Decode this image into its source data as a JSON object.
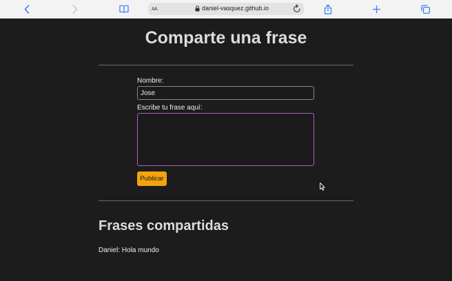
{
  "browser": {
    "aa_label": "AA",
    "url": "daniel-vasquez.github.io",
    "icons": [
      "chevron-left-icon",
      "chevron-right-icon",
      "book-icon",
      "lock-icon",
      "reload-icon",
      "share-icon",
      "plus-icon",
      "tabs-icon"
    ]
  },
  "page": {
    "title": "Comparte una frase",
    "form": {
      "name_label": "Nombre:",
      "name_value": "Jose",
      "phrase_label": "Escribe tu frase aquí:",
      "phrase_value": "",
      "publish_label": "Publicar"
    },
    "shared": {
      "title": "Frases compartidas",
      "items": [
        "Daniel: Hola mundo"
      ]
    }
  },
  "colors": {
    "background": "#1c1c1c",
    "accent_button": "#f4a30f",
    "focus_border": "#b25dc4",
    "toolbar": "#f3f3f3",
    "browser_accent": "#2f7cf6"
  }
}
